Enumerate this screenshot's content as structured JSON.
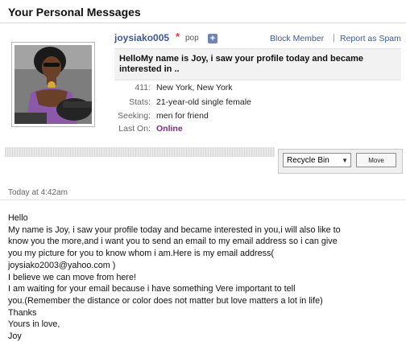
{
  "page": {
    "title": "Your Personal Messages"
  },
  "sender": {
    "username": "joysiako005",
    "asterisk": "*",
    "tag": "pop",
    "add_icon": "+",
    "block_label": "Block Member",
    "separator": "|",
    "report_label": "Report as Spam"
  },
  "subject": "HelloMy name is Joy, i saw your profile today and became interested in ..",
  "profile": {
    "location_label": "411:",
    "location_value": "New York, New York",
    "stats_label": "Stats:",
    "stats_value": "21-year-old single female",
    "seeking_label": "Seeking:",
    "seeking_value": "men for friend",
    "lastOn_label": "Last On:",
    "lastOn_value": "Online"
  },
  "toolbar": {
    "folder_selected": "Recycle Bin",
    "move_label": "Move"
  },
  "timestamp": "Today at 4:42am",
  "message_lines": [
    "Hello",
    "My name is Joy, i saw your profile today and became interested in you,i will also like to",
    "know you the more,and i want you to send an email to my email address so i can give",
    "you my picture for you to know whom i am.Here is my email address(",
    "joysiako2003@yahoo.com )",
    "I believe we can move from here!",
    "I am waiting for your email because i have something Vere important to tell",
    "you.(Remember the distance or color does not matter but love matters a lot in life)",
    "Thanks",
    "Yours in love,",
    "Joy"
  ]
}
